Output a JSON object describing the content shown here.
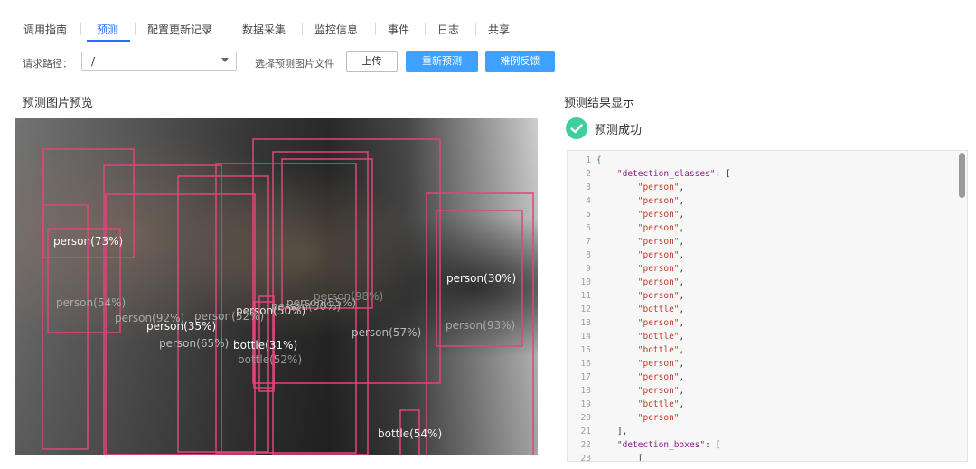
{
  "tabs": [
    {
      "label": "调用指南",
      "active": false
    },
    {
      "label": "预测",
      "active": true
    },
    {
      "label": "配置更新记录",
      "active": false
    },
    {
      "label": "数据采集",
      "active": false
    },
    {
      "label": "监控信息",
      "active": false
    },
    {
      "label": "事件",
      "active": false
    },
    {
      "label": "日志",
      "active": false
    },
    {
      "label": "共享",
      "active": false
    }
  ],
  "request": {
    "path_label": "请求路径：",
    "path_value": "/",
    "choose_file_label": "选择预测图片文件",
    "upload_button": "上传",
    "repredict_button": "重新预测",
    "feedback_button": "难例反馈"
  },
  "preview": {
    "title": "预测图片预览",
    "detections": [
      {
        "label": "person(73%)",
        "score": 0.73
      },
      {
        "label": "person(54%)",
        "score": 0.54
      },
      {
        "label": "person(92%)",
        "score": 0.92
      },
      {
        "label": "person(52%)",
        "score": 0.52
      },
      {
        "label": "person(35%)",
        "score": 0.35
      },
      {
        "label": "person(65%)",
        "score": 0.65
      },
      {
        "label": "person(50%)",
        "score": 0.5
      },
      {
        "label": "person(50%)",
        "score": 0.5
      },
      {
        "label": "person(55%)",
        "score": 0.55
      },
      {
        "label": "person(98%)",
        "score": 0.98
      },
      {
        "label": "bottle(31%)",
        "score": 0.31
      },
      {
        "label": "bottle(52%)",
        "score": 0.52
      },
      {
        "label": "person(57%)",
        "score": 0.57
      },
      {
        "label": "person(30%)",
        "score": 0.3
      },
      {
        "label": "person(93%)",
        "score": 0.93
      },
      {
        "label": "bottle(54%)",
        "score": 0.54
      }
    ]
  },
  "result": {
    "title": "预测结果显示",
    "status_text": "预测成功",
    "status_icon": "check-circle-icon",
    "status_color": "#3fcf9a",
    "code_lines": [
      {
        "n": "1",
        "text": "{"
      },
      {
        "n": "2",
        "text": "    \"detection_classes\": ["
      },
      {
        "n": "3",
        "text": "        \"person\","
      },
      {
        "n": "4",
        "text": "        \"person\","
      },
      {
        "n": "5",
        "text": "        \"person\","
      },
      {
        "n": "6",
        "text": "        \"person\","
      },
      {
        "n": "7",
        "text": "        \"person\","
      },
      {
        "n": "8",
        "text": "        \"person\","
      },
      {
        "n": "9",
        "text": "        \"person\","
      },
      {
        "n": "10",
        "text": "        \"person\","
      },
      {
        "n": "11",
        "text": "        \"person\","
      },
      {
        "n": "12",
        "text": "        \"bottle\","
      },
      {
        "n": "13",
        "text": "        \"person\","
      },
      {
        "n": "14",
        "text": "        \"bottle\","
      },
      {
        "n": "15",
        "text": "        \"bottle\","
      },
      {
        "n": "16",
        "text": "        \"person\","
      },
      {
        "n": "17",
        "text": "        \"person\","
      },
      {
        "n": "18",
        "text": "        \"person\","
      },
      {
        "n": "19",
        "text": "        \"bottle\","
      },
      {
        "n": "20",
        "text": "        \"person\""
      },
      {
        "n": "21",
        "text": "    ],"
      },
      {
        "n": "22",
        "text": "    \"detection_boxes\": ["
      },
      {
        "n": "23",
        "text": "        ["
      }
    ]
  },
  "colors": {
    "accent": "#1f72ff",
    "primary_button": "#3ea0ff",
    "box_stroke": "#e0457a"
  }
}
